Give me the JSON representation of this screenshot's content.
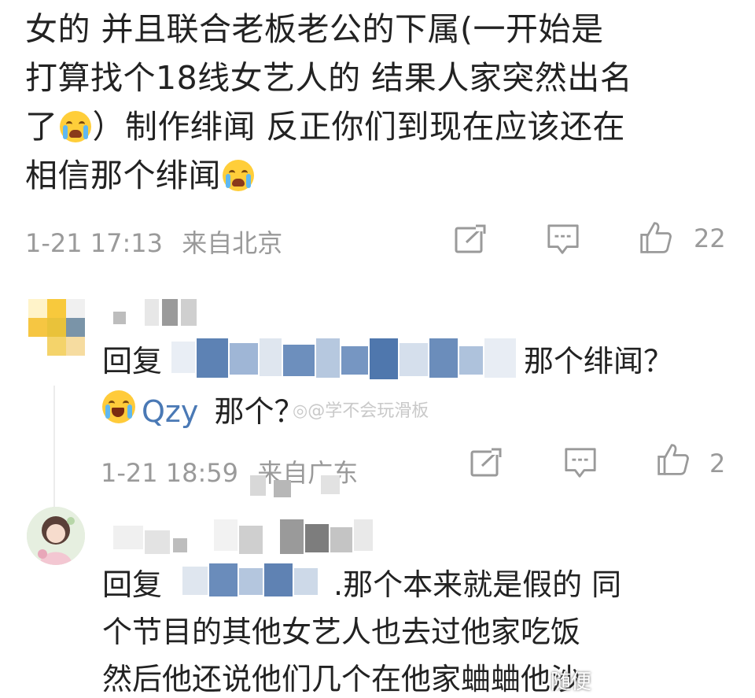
{
  "comment1": {
    "line1": "女的  并且联合老板老公的下属(一开始是",
    "line2": "打算找个18线女艺人的  结果人家突然出名",
    "line3_pre": "了",
    "line3_post": "）制作绯闻  反正你们到现在应该还在",
    "line4": "相信那个绯闻",
    "timestamp": "1-21 17:13",
    "location": "来自北京",
    "like_count": "22"
  },
  "reply1": {
    "prefix": "回复",
    "suffix": "那个绯闻？",
    "mention": "Qzy",
    "text": "那个？",
    "timestamp": "1-21 18:59",
    "location": "来自广东",
    "like_count": "2"
  },
  "reply2": {
    "prefix": "回复",
    "line1_suffix": ".那个本来就是假的  同",
    "line2": "个节目的其他女艺人也去过他家吃饭",
    "line3": "然后他还说他们几个在他家蛐蛐他沙"
  },
  "watermark": {
    "text": "@学不会玩滑板",
    "corner_text": "随便"
  },
  "colors": {
    "meta_gray": "#9a9a9a",
    "mention_blue": "#4a79b5"
  },
  "icons": {
    "share": "share-icon",
    "comment": "comment-icon",
    "like": "thumbs-up-icon"
  }
}
